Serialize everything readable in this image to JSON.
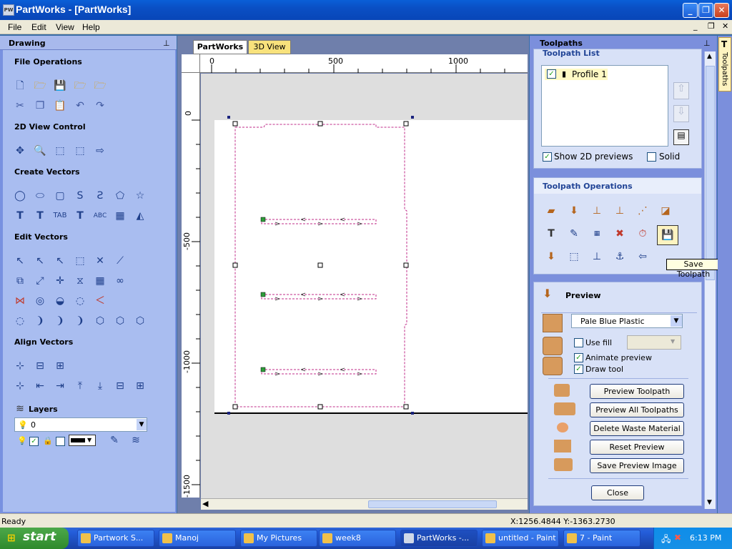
{
  "window": {
    "title": "PartWorks - [PartWorks]",
    "logo": "PW",
    "minimize_icon": "minimize-icon",
    "maximize_icon": "maximize-icon",
    "close_icon": "close-icon"
  },
  "menu": {
    "items": [
      "File",
      "Edit",
      "View",
      "Help"
    ]
  },
  "left_panel": {
    "title": "Drawing",
    "pin_icon": "pin-icon",
    "sections": {
      "file_operations": "File Operations",
      "view_control": "2D View Control",
      "create_vectors": "Create Vectors",
      "edit_vectors": "Edit Vectors",
      "align_vectors": "Align Vectors",
      "layers": "Layers"
    },
    "layer_select_value": "0"
  },
  "document": {
    "tabs": [
      "PartWorks",
      "3D View"
    ],
    "active_tab": "PartWorks",
    "ruler_top_labels": [
      "0",
      "500",
      "1000"
    ],
    "ruler_left_labels": [
      "0",
      "-500",
      "-1000",
      "-1500"
    ]
  },
  "right_panel": {
    "title": "Toolpaths",
    "vertical_tab_label": "Toolpaths",
    "toolpath_list": {
      "header": "Toolpath List",
      "items": [
        {
          "label": "Profile 1",
          "checked": true
        }
      ],
      "show_2d_previews_label": "Show 2D previews",
      "show_2d_previews_checked": true,
      "solid_label": "Solid",
      "solid_checked": false
    },
    "operations": {
      "header": "Toolpath Operations",
      "tooltip": "Save Toolpath"
    },
    "preview": {
      "header": "Preview",
      "material_value": "Pale Blue Plastic",
      "use_fill_label": "Use fill",
      "use_fill_checked": false,
      "animate_preview_label": "Animate preview",
      "animate_preview_checked": true,
      "draw_tool_label": "Draw tool",
      "draw_tool_checked": true,
      "buttons": {
        "preview_toolpath": "Preview Toolpath",
        "preview_all_toolpaths": "Preview All Toolpaths",
        "delete_waste_material": "Delete Waste Material",
        "reset_preview": "Reset Preview",
        "save_preview_image": "Save Preview Image",
        "close": "Close"
      }
    }
  },
  "status": {
    "text": "Ready",
    "coords": "X:1256.4844 Y:-1363.2730"
  },
  "taskbar": {
    "start_label": "start",
    "items": [
      "Partwork S...",
      "Manoj",
      "My Pictures",
      "week8",
      "PartWorks -...",
      "untitled - Paint",
      "7 - Paint"
    ],
    "active_item": "PartWorks -...",
    "clock": "6:13 PM"
  }
}
